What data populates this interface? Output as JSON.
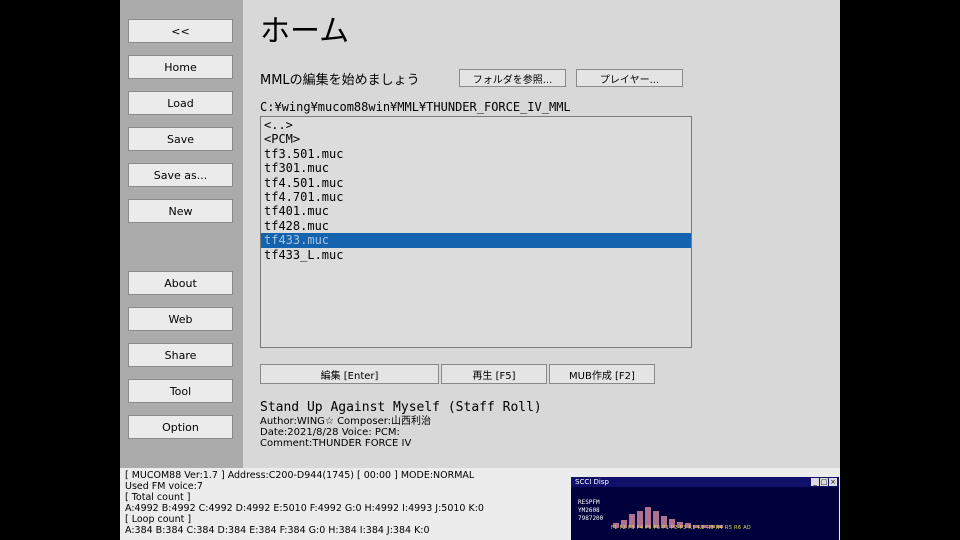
{
  "sidebar": {
    "collapse_label": "<<",
    "items": [
      "Home",
      "Load",
      "Save",
      "Save as...",
      "New"
    ],
    "bottom_items": [
      "About",
      "Web",
      "Share",
      "Tool",
      "Option"
    ]
  },
  "main": {
    "title": "ホーム",
    "subtitle": "MMLの編集を始めましょう",
    "browse_button": "フォルダを参照...",
    "player_button": "プレイヤー...",
    "path": "C:¥wing¥mucom88win¥MML¥THUNDER_FORCE_IV_MML",
    "files": [
      "<..>",
      "<PCM>",
      "tf3.501.muc",
      "tf301.muc",
      "tf4.501.muc",
      "tf4.701.muc",
      "tf401.muc",
      "tf428.muc",
      "tf433.muc",
      "tf433_L.muc"
    ],
    "selected_file": "tf433.muc",
    "edit_button": "編集 [Enter]",
    "play_button": "再生 [F5]",
    "mub_button": "MUB作成 [F2]",
    "song_title": "Stand Up Against Myself (Staff Roll)",
    "author_line": "Author:WING☆  Composer:山西利治",
    "date_line": "Date:2021/8/28  Voice:  PCM:",
    "comment_line": "Comment:THUNDER FORCE IV"
  },
  "status": {
    "line1": "[  MUCOM88 Ver:1.7  ]  Address:C200-D944(1745)          [ 00:00 ] MODE:NORMAL",
    "line2": "Used FM voice:7",
    "line3": "[ Total count ]",
    "line4": "A:4992 B:4992 C:4992 D:4992 E:5010 F:4992 G:0 H:4992 I:4993 J:5010 K:0",
    "line5": "[ Loop count  ]",
    "line6": "A:384 B:384 C:384 D:384 E:384 F:384 G:0 H:384 I:384 J:384 K:0"
  },
  "scci": {
    "title": "SCCI Disp",
    "readout": [
      "RESPFM",
      "YM2608",
      "7987200"
    ],
    "levels": [
      0.15,
      0.25,
      0.45,
      0.55,
      0.7,
      0.55,
      0.4,
      0.3,
      0.2,
      0.15,
      0.1,
      0.1,
      0.1,
      0.1
    ],
    "bar_color": "#b07090",
    "labels": "F1 F2 F3 F4 F5 F6 P1 P2 P3 R1 R2 R3 R4 R5 R6 AD"
  }
}
